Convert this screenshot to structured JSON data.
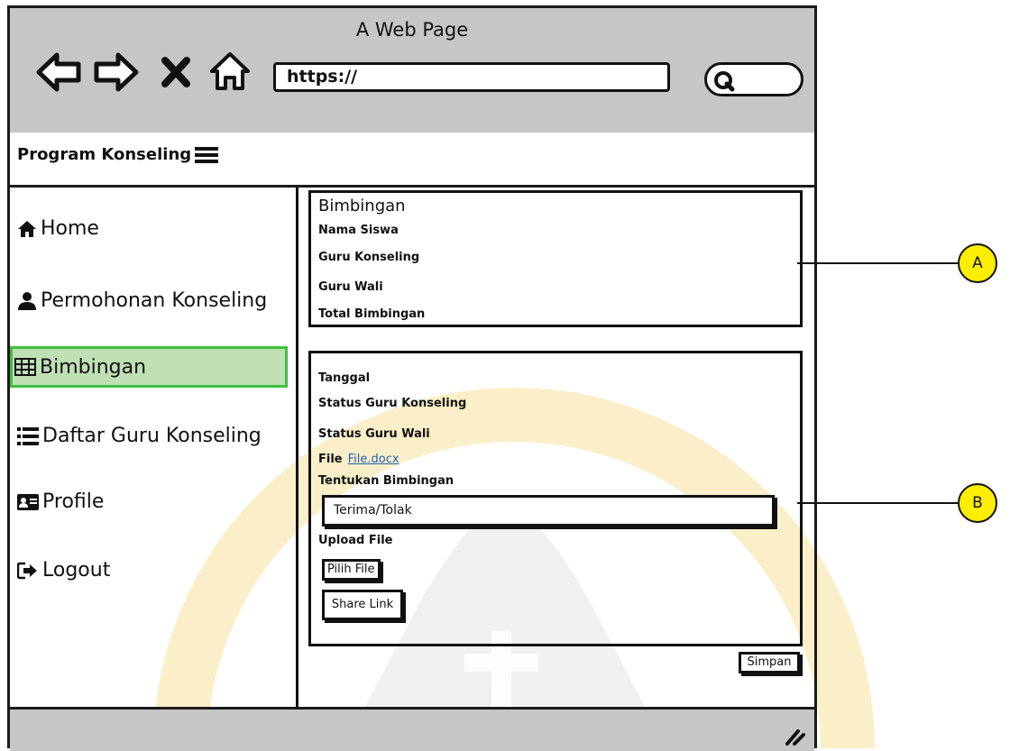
{
  "window": {
    "title": "A Web Page",
    "url": "https://"
  },
  "app": {
    "title": "Program Konseling"
  },
  "sidebar": {
    "items": [
      {
        "label": "Home",
        "icon": "home-icon"
      },
      {
        "label": "Permohonan Konseling",
        "icon": "user-icon"
      },
      {
        "label": "Bimbingan",
        "icon": "table-icon",
        "active": true
      },
      {
        "label": "Daftar Guru Konseling",
        "icon": "list-icon"
      },
      {
        "label": "Profile",
        "icon": "id-card-icon"
      },
      {
        "label": "Logout",
        "icon": "logout-icon"
      }
    ]
  },
  "panel_a": {
    "title": "Bimbingan",
    "fields": [
      "Nama Siswa",
      "Guru Konseling",
      "Guru Wali",
      "Total Bimbingan"
    ]
  },
  "panel_b": {
    "tanggal": "Tanggal",
    "status_guru_konseling": "Status Guru Konseling",
    "status_guru_wali": "Status Guru Wali",
    "file_label": "File",
    "file_link": "File.docx",
    "tentukan_label": "Tentukan Bimbingan",
    "select_value": "Terima/Tolak",
    "upload_label": "Upload File",
    "pilih_file": "Pilih File",
    "share_link": "Share Link"
  },
  "save_label": "Simpan",
  "callouts": {
    "a": "A",
    "b": "B"
  },
  "colors": {
    "chrome": "#c6c6c6",
    "active_bg": "#bfe0b5",
    "active_border": "#3fbf3f",
    "callout": "#ffee00",
    "link": "#2060b0"
  }
}
